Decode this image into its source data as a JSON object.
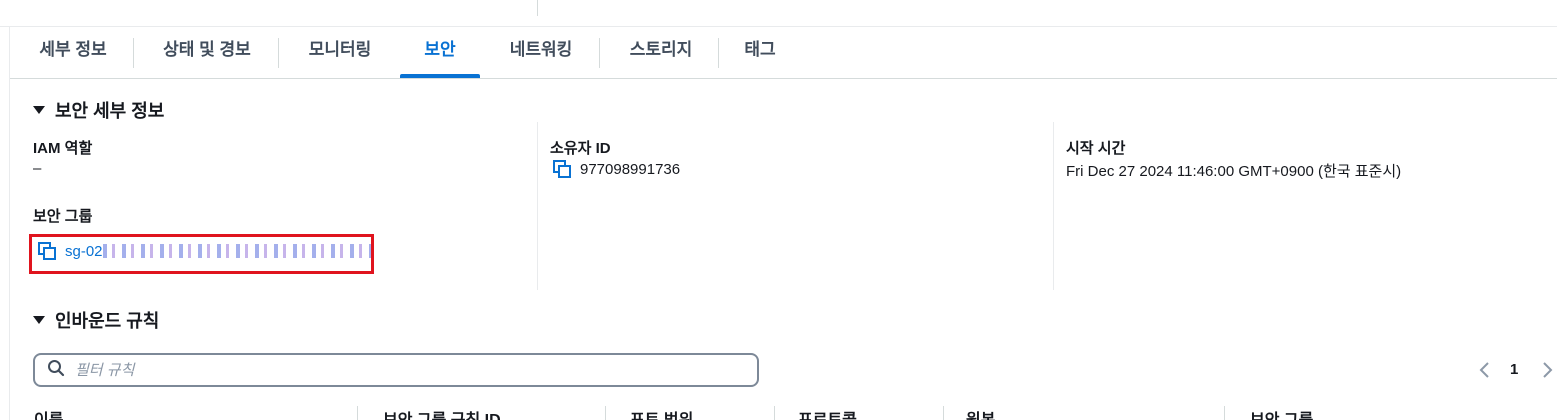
{
  "tabs": [
    {
      "label": "세부 정보"
    },
    {
      "label": "상태 및 경보"
    },
    {
      "label": "모니터링"
    },
    {
      "label": "보안"
    },
    {
      "label": "네트워킹"
    },
    {
      "label": "스토리지"
    },
    {
      "label": "태그"
    }
  ],
  "active_tab": "보안",
  "security_details": {
    "title": "보안 세부 정보",
    "iam_role": {
      "label": "IAM 역할",
      "value": "–"
    },
    "owner_id": {
      "label": "소유자 ID",
      "value": "977098991736"
    },
    "launch_time": {
      "label": "시작 시간",
      "value": "Fri Dec 27 2024 11:46:00 GMT+0900 (한국 표준시)"
    },
    "security_groups": {
      "label": "보안 그룹",
      "value_prefix": "sg-02"
    }
  },
  "inbound_rules": {
    "title": "인바운드 규칙",
    "search_placeholder": "필터 규칙",
    "page": "1",
    "columns": [
      "이름",
      "보안 그룹 규칙 ID",
      "포트 범위",
      "프로토콜",
      "원본",
      "보안 그룹"
    ]
  },
  "colors": {
    "accent": "#0972d3",
    "highlight": "#e0141e",
    "text": "#16191f"
  },
  "icons": [
    "copy-icon",
    "search-icon",
    "caret-down-icon",
    "chevron-left-icon",
    "chevron-right-icon"
  ]
}
